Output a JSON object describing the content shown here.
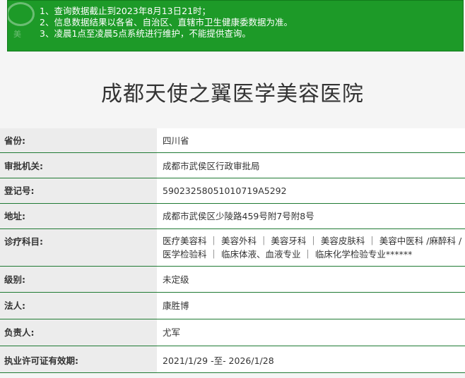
{
  "notice": {
    "lines": [
      "1、查询数据截止到2023年8月13日21时；",
      "2、信息数据结果以各省、自治区、直辖市卫生健康委数据为准。",
      "3、凌晨1点至凌晨5点系统进行维护，不能提供查询。"
    ]
  },
  "title": "成都天使之翼医学美容医院",
  "rows": [
    {
      "label": "省份:",
      "value": "四川省"
    },
    {
      "label": "审批机关:",
      "value": "成都市武侯区行政审批局"
    },
    {
      "label": "登记号:",
      "value": "59023258051010719A5292"
    },
    {
      "label": "地址:",
      "value": "成都市武侯区少陵路459号附7号附8号"
    },
    {
      "label": "诊疗科目:",
      "value": "医疗美容科 ｜ 美容外科 ｜ 美容牙科 ｜ 美容皮肤科 ｜ 美容中医科 /麻醉科 / 医学检验科 ｜ 临床体液、血液专业 ｜ 临床化学检验专业******"
    },
    {
      "label": "级别:",
      "value": "未定级"
    },
    {
      "label": "法人:",
      "value": "康胜博"
    },
    {
      "label": "负责人:",
      "value": "尤军"
    },
    {
      "label": "执业许可证有效期:",
      "value": "2021/1/29 -至- 2026/1/28"
    }
  ]
}
